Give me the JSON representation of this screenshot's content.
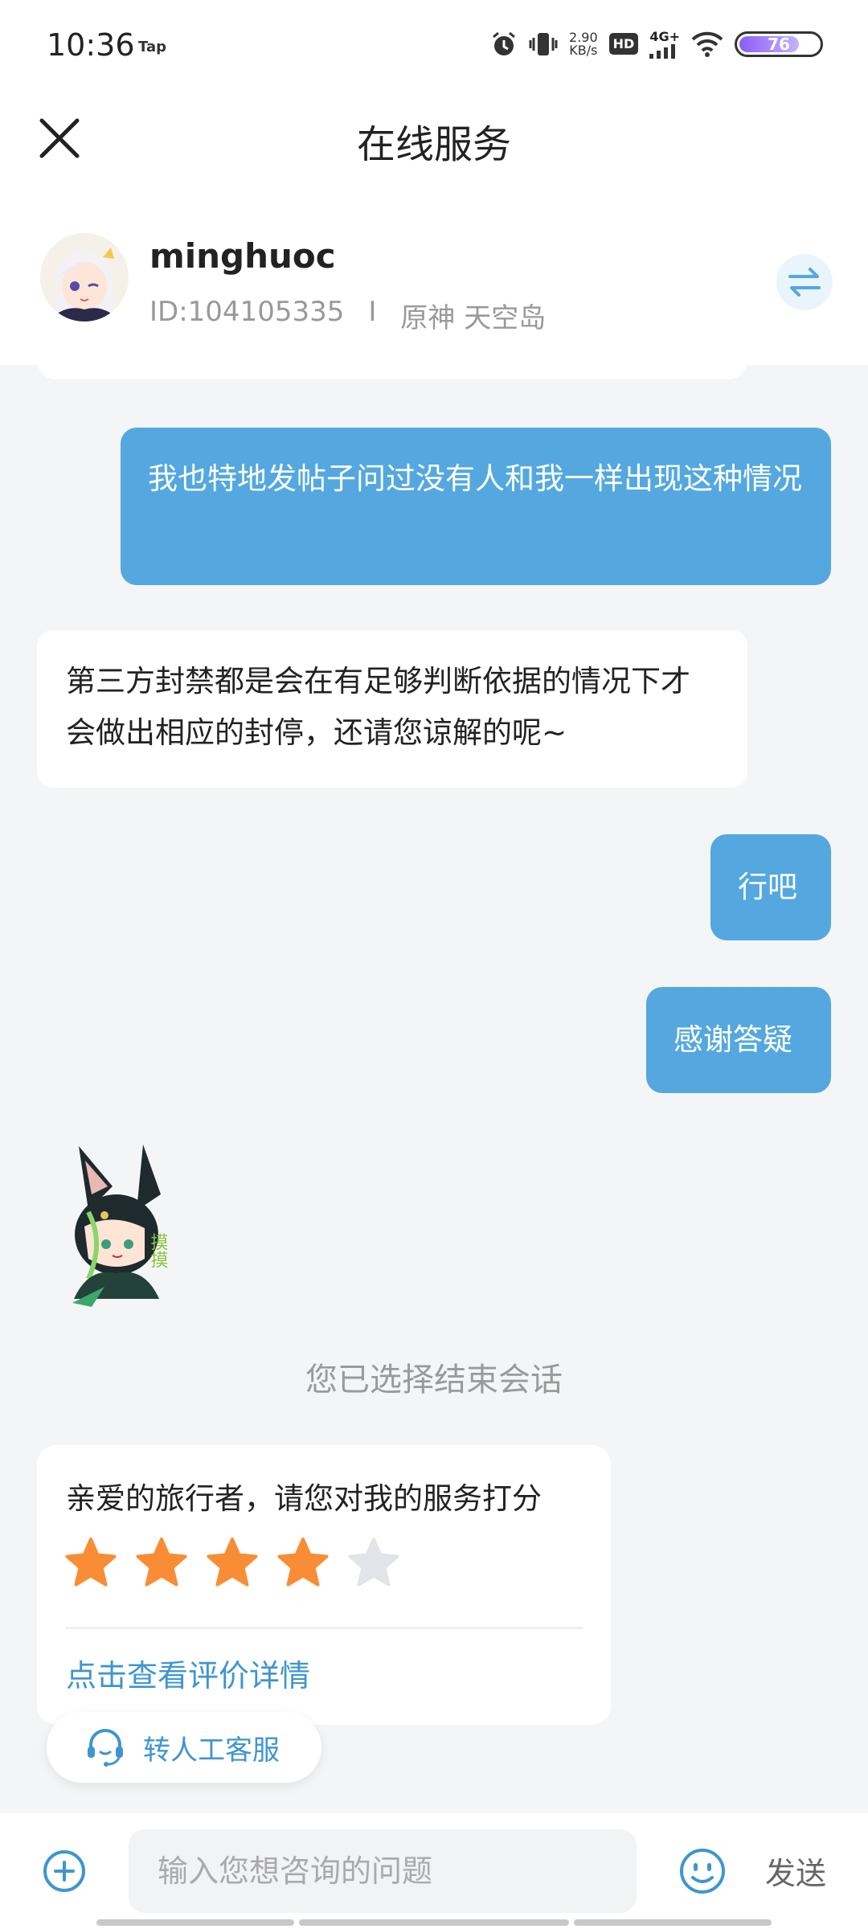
{
  "status_bar": {
    "time": "10:36",
    "tap_label": "Tap",
    "net_speed_value": "2.90",
    "net_speed_unit": "KB/s",
    "hd_label": "HD",
    "signal_label": "4G+",
    "battery_level": "76"
  },
  "header": {
    "title": "在线服务"
  },
  "user": {
    "name": "minghuoc",
    "id_text": "ID:104105335",
    "separator": "I",
    "server_text": "原神 天空岛"
  },
  "messages": [
    {
      "from": "user",
      "text": "我也特地发帖子问过没有人和我一样出现这种情况"
    },
    {
      "from": "agent",
      "text": "第三方封禁都是会在有足够判断依据的情况下才会做出相应的封停，还请您谅解的呢~"
    },
    {
      "from": "user",
      "text": "行吧"
    },
    {
      "from": "user",
      "text": "感谢答疑"
    }
  ],
  "sticker": {
    "icon": "fox-character-sticker",
    "caption": "摸摸"
  },
  "system_note": "您已选择结束会话",
  "rating": {
    "question": "亲爱的旅行者，请您对我的服务打分",
    "score": 4,
    "max": 5,
    "link_label": "点击查看评价详情"
  },
  "human_agent_button": {
    "label": "转人工客服",
    "icon": "headset-icon"
  },
  "input_bar": {
    "placeholder": "输入您想咨询的问题",
    "send_label": "发送"
  },
  "colors": {
    "accent": "#54a8df",
    "link": "#3f95cf",
    "star_filled": "#f98d35",
    "star_empty": "#e3e4ea",
    "background": "#f4f5f7"
  }
}
